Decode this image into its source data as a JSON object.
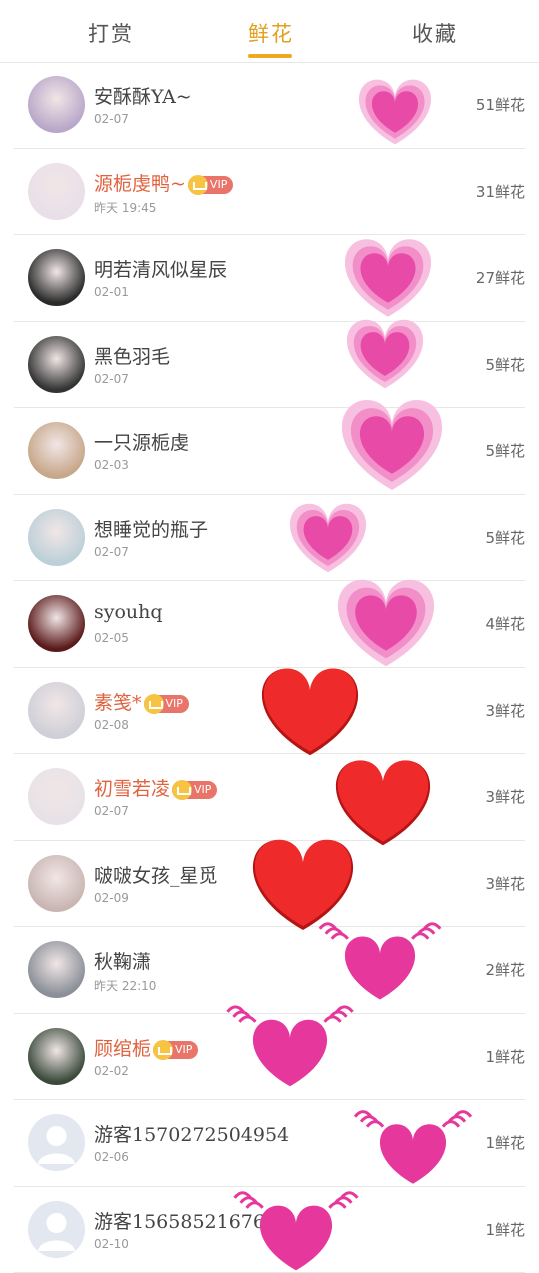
{
  "tabs": [
    {
      "label": "打赏"
    },
    {
      "label": "鲜花",
      "active": true
    },
    {
      "label": "收藏"
    }
  ],
  "colors": {
    "accent": "#f0a81c",
    "vip_name": "#e0623f",
    "vip_badge": "#e8746a"
  },
  "vip_label": "VIP",
  "rows": [
    {
      "name": "安酥酥YA~",
      "date": "02-07",
      "count": "51鲜花",
      "vip": false,
      "avatar_icon": "avatar-photo"
    },
    {
      "name": "源栀虔鸭~",
      "date": "昨天 19:45",
      "count": "31鲜花",
      "vip": true,
      "avatar_icon": "avatar-photo"
    },
    {
      "name": "明若清风似星辰",
      "date": "02-01",
      "count": "27鲜花",
      "vip": false,
      "avatar_icon": "avatar-photo"
    },
    {
      "name": "黑色羽毛",
      "date": "02-07",
      "count": "5鲜花",
      "vip": false,
      "avatar_icon": "avatar-photo"
    },
    {
      "name": "一只源栀虔",
      "date": "02-03",
      "count": "5鲜花",
      "vip": false,
      "avatar_icon": "avatar-photo"
    },
    {
      "name": "想睡觉的瓶子",
      "date": "02-07",
      "count": "5鲜花",
      "vip": false,
      "avatar_icon": "avatar-photo"
    },
    {
      "name": "syouhq",
      "date": "02-05",
      "count": "4鲜花",
      "vip": false,
      "avatar_icon": "avatar-photo"
    },
    {
      "name": "素笺*",
      "date": "02-08",
      "count": "3鲜花",
      "vip": true,
      "avatar_icon": "avatar-photo"
    },
    {
      "name": "初雪若凌",
      "date": "02-07",
      "count": "3鲜花",
      "vip": true,
      "avatar_icon": "avatar-photo"
    },
    {
      "name": "啵啵女孩_星觅",
      "date": "02-09",
      "count": "3鲜花",
      "vip": false,
      "avatar_icon": "avatar-photo"
    },
    {
      "name": "秋鞠潇",
      "date": "昨天 22:10",
      "count": "2鲜花",
      "vip": false,
      "avatar_icon": "avatar-photo"
    },
    {
      "name": "顾绾栀",
      "date": "02-02",
      "count": "1鲜花",
      "vip": true,
      "avatar_icon": "avatar-photo"
    },
    {
      "name": "游客1570272504954",
      "date": "02-06",
      "count": "1鲜花",
      "vip": false,
      "avatar_icon": "default-avatar-icon"
    },
    {
      "name": "游客1565852167662",
      "date": "02-10",
      "count": "1鲜花",
      "vip": false,
      "avatar_icon": "default-avatar-icon"
    }
  ]
}
